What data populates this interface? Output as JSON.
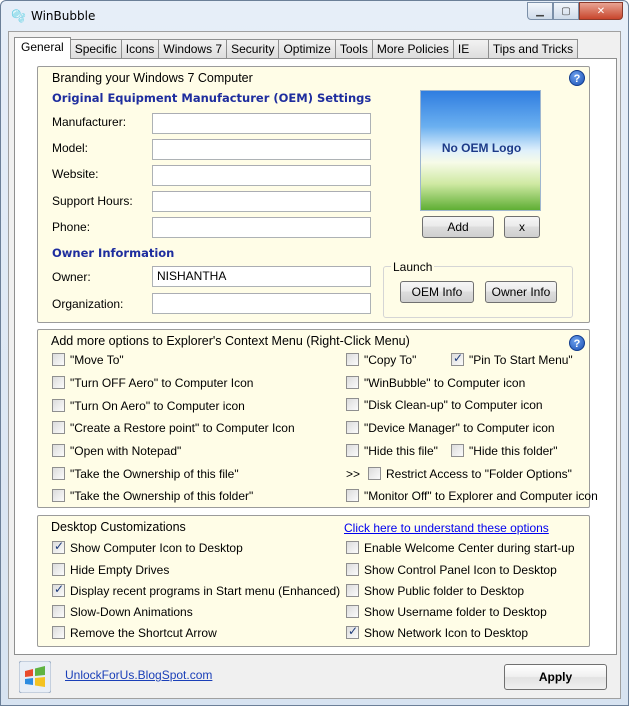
{
  "window": {
    "title": "WinBubble"
  },
  "tabs": [
    "General",
    "Specific",
    "Icons",
    "Windows 7",
    "Security",
    "Optimize",
    "Tools",
    "More Policies",
    "IE",
    "Tips and Tricks"
  ],
  "branding": {
    "title": "Branding your Windows 7 Computer",
    "oem_heading": "Original Equipment Manufacturer (OEM) Settings",
    "fields": [
      {
        "label": "Manufacturer:",
        "value": ""
      },
      {
        "label": "Model:",
        "value": ""
      },
      {
        "label": "Website:",
        "value": ""
      },
      {
        "label": "Support Hours:",
        "value": ""
      },
      {
        "label": "Phone:",
        "value": ""
      }
    ],
    "logo_text": "No OEM Logo",
    "add_label": "Add",
    "remove_label": "x",
    "owner_heading": "Owner Information",
    "owner_label": "Owner:",
    "owner_value": "NISHANTHA",
    "org_label": "Organization:",
    "org_value": "",
    "launch_title": "Launch",
    "oem_info_label": "OEM Info",
    "owner_info_label": "Owner Info"
  },
  "context_menu": {
    "title": "Add more  options to Explorer's Context Menu (Right-Click Menu)",
    "left": [
      {
        "label": "\"Move To\"",
        "checked": false
      },
      {
        "label": "\"Turn OFF Aero\" to Computer Icon",
        "checked": false
      },
      {
        "label": "\"Turn On Aero\" to Computer icon",
        "checked": false
      },
      {
        "label": "\"Create a Restore point\" to Computer Icon",
        "checked": false
      },
      {
        "label": "\"Open with Notepad\"",
        "checked": false
      },
      {
        "label": "\"Take the Ownership of this file\"",
        "checked": false
      },
      {
        "label": "\"Take the Ownership of this folder\"",
        "checked": false
      }
    ],
    "copy_to": {
      "label": "\"Copy To\"",
      "checked": false
    },
    "pin_to_start": {
      "label": "\"Pin To Start Menu\"",
      "checked": true
    },
    "winbubble": {
      "label": "\"WinBubble\" to Computer icon",
      "checked": false
    },
    "disk_cleanup": {
      "label": "\"Disk Clean-up\" to Computer icon",
      "checked": false
    },
    "device_manager": {
      "label": "\"Device Manager\" to Computer icon",
      "checked": false
    },
    "hide_file": {
      "label": "\"Hide this file\"",
      "checked": false
    },
    "hide_folder": {
      "label": "\"Hide this folder\"",
      "checked": false
    },
    "arrow": ">>",
    "restrict_access": {
      "label": "Restrict Access to \"Folder Options\"",
      "checked": false
    },
    "monitor_off": {
      "label": "\"Monitor Off\" to Explorer and Computer icon",
      "checked": false
    }
  },
  "desktop": {
    "title": "Desktop Customizations",
    "link": "Click here to understand these options",
    "left": [
      {
        "label": "Show Computer Icon to Desktop",
        "checked": true
      },
      {
        "label": "Hide Empty Drives",
        "checked": false
      },
      {
        "label": "Display recent programs in Start menu (Enhanced)",
        "checked": true
      },
      {
        "label": "Slow-Down Animations",
        "checked": false
      },
      {
        "label": "Remove the Shortcut Arrow",
        "checked": false
      }
    ],
    "right": [
      {
        "label": "Enable Welcome Center during start-up",
        "checked": false
      },
      {
        "label": "Show Control Panel Icon to Desktop",
        "checked": false
      },
      {
        "label": "Show Public folder to Desktop",
        "checked": false
      },
      {
        "label": "Show Username folder to Desktop",
        "checked": false
      },
      {
        "label": "Show Network Icon to Desktop",
        "checked": true
      }
    ]
  },
  "footer": {
    "link": "UnlockForUs.BlogSpot.com",
    "apply_label": "Apply"
  },
  "icons": {
    "app": "bubble-icon",
    "help": "help-icon",
    "footer_logo": "windows-logo-icon"
  }
}
